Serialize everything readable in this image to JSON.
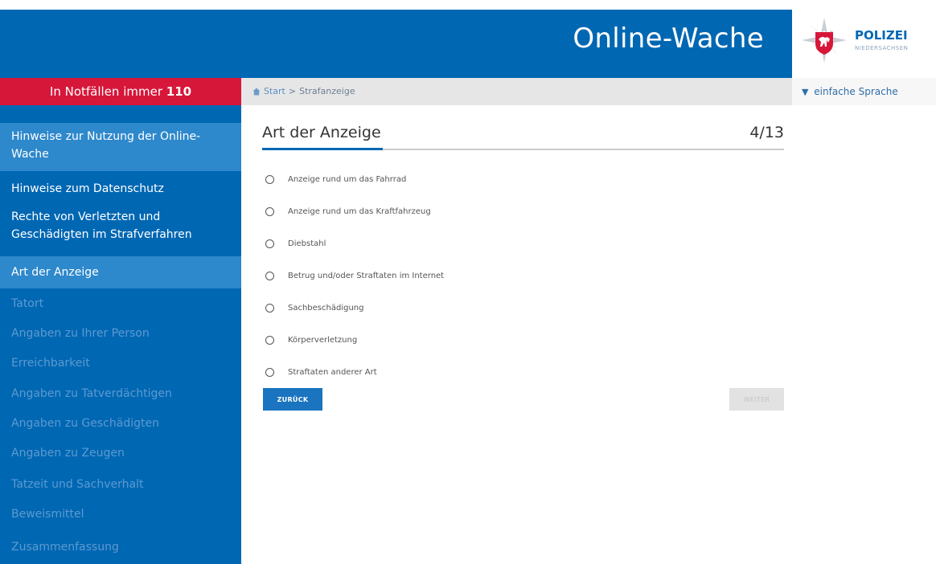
{
  "header": {
    "title": "Online-Wache",
    "logo_text": "POLIZEI",
    "logo_sub": "NIEDERSACHSEN",
    "brand_color": "#0067b3"
  },
  "emergency": {
    "prefix": "In Notfällen immer",
    "number": "110",
    "color": "#d6173a"
  },
  "breadcrumb": {
    "home_icon": "home-icon",
    "start": "Start",
    "separator": ">",
    "current": "Strafanzeige"
  },
  "simple_language": {
    "icon": "filter-icon",
    "label": "einfache Sprache"
  },
  "sidebar": {
    "items": [
      {
        "label": "Hinweise zur Nutzung der Online-Wache",
        "state": "done-highlight"
      },
      {
        "label": "Hinweise zum Datenschutz",
        "state": "done"
      },
      {
        "label": "Rechte von Verletzten und Geschädigten im Strafverfahren",
        "state": "done"
      },
      {
        "label": "Art der Anzeige",
        "state": "active"
      },
      {
        "label": "Tatort",
        "state": "disabled"
      },
      {
        "label": "Angaben zu Ihrer Person",
        "state": "disabled"
      },
      {
        "label": "Erreichbarkeit",
        "state": "disabled"
      },
      {
        "label": "Angaben zu Tatverdächtigen",
        "state": "disabled"
      },
      {
        "label": "Angaben zu Geschädigten",
        "state": "disabled"
      },
      {
        "label": "Angaben zu Zeugen",
        "state": "disabled"
      },
      {
        "label": "Tatzeit und Sachverhalt",
        "state": "disabled"
      },
      {
        "label": "Beweismittel",
        "state": "disabled"
      },
      {
        "label": "Zusammenfassung",
        "state": "disabled"
      }
    ]
  },
  "main": {
    "heading": "Art der Anzeige",
    "step": "4/13",
    "progress": 0.2308,
    "options": [
      "Anzeige rund um das Fahrrad",
      "Anzeige rund um das Kraftfahrzeug",
      "Diebstahl",
      "Betrug und/oder Straftaten im Internet",
      "Sachbeschädigung",
      "Körperverletzung",
      "Straftaten anderer Art"
    ],
    "back_label": "ZURÜCK",
    "next_label": "WEITER"
  }
}
